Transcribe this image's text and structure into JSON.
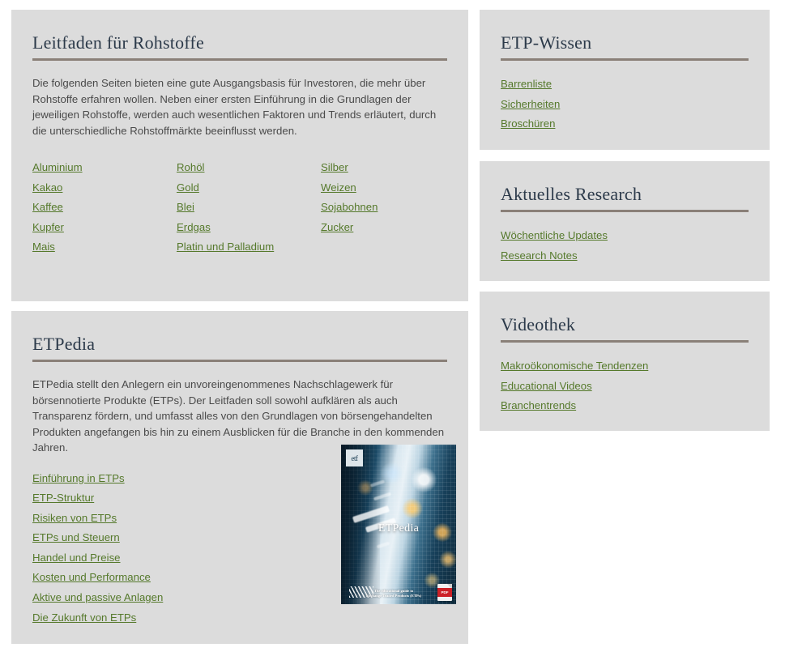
{
  "cards": {
    "commodities": {
      "title": "Leitfaden für Rohstoffe",
      "intro": "Die folgenden Seiten bieten eine gute Ausgangsbasis für Investoren, die mehr über Rohstoffe erfahren wollen. Neben einer ersten Einführung in die Grundlagen der jeweiligen Rohstoffe, werden auch wesentlichen Faktoren und Trends erläutert, durch die unterschiedliche Rohstoffmärkte beeinflusst werden.",
      "links": [
        "Aluminium",
        "Rohöl",
        "Silber",
        "Kakao",
        "Gold",
        "Weizen",
        "Kaffee",
        "Blei",
        "Sojabohnen",
        "Kupfer",
        "Erdgas",
        "Zucker",
        "Mais",
        "Platin und Palladium",
        ""
      ]
    },
    "etpedia": {
      "title": "ETPedia",
      "intro": "ETPedia stellt den Anlegern ein unvoreingenommenes Nachschlagewerk für börsennotierte Produkte (ETPs). Der Leitfaden soll sowohl aufklären als auch Transparenz fördern, und umfasst alles von den Grundlagen von börsengehandelten Produkten angefangen bis hin zu einem Ausblicken für die Branche in den kommenden Jahren.",
      "links": [
        "Einführung in ETPs",
        "ETP-Struktur",
        "Risiken von ETPs",
        "ETPs und Steuern",
        "Handel und Preise",
        "Kosten und Performance",
        "Aktive und passive Anlagen",
        "Die Zukunft von ETPs"
      ],
      "cover": {
        "logo_text": "etf",
        "title": "ETPedia",
        "footer_line1": "The educational guide to",
        "footer_line2": "Exchange Traded Products (ETPs)",
        "badge_label": "PDF"
      }
    },
    "etp_wissen": {
      "title": "ETP-Wissen",
      "links": [
        "Barrenliste",
        "Sicherheiten",
        "Broschüren"
      ]
    },
    "research": {
      "title": "Aktuelles Research",
      "links": [
        "Wöchentliche Updates",
        "Research Notes"
      ]
    },
    "videothek": {
      "title": "Videothek",
      "links": [
        "Makroökonomische Tendenzen",
        "Educational Videos",
        "Branchentrends"
      ]
    }
  },
  "colors": {
    "card_background": "#dcdcdc",
    "page_background": "#ffffff",
    "link": "#55792b",
    "heading": "#2c3a4a",
    "rule": "#8a8078",
    "body_text": "#4a4a4a"
  }
}
